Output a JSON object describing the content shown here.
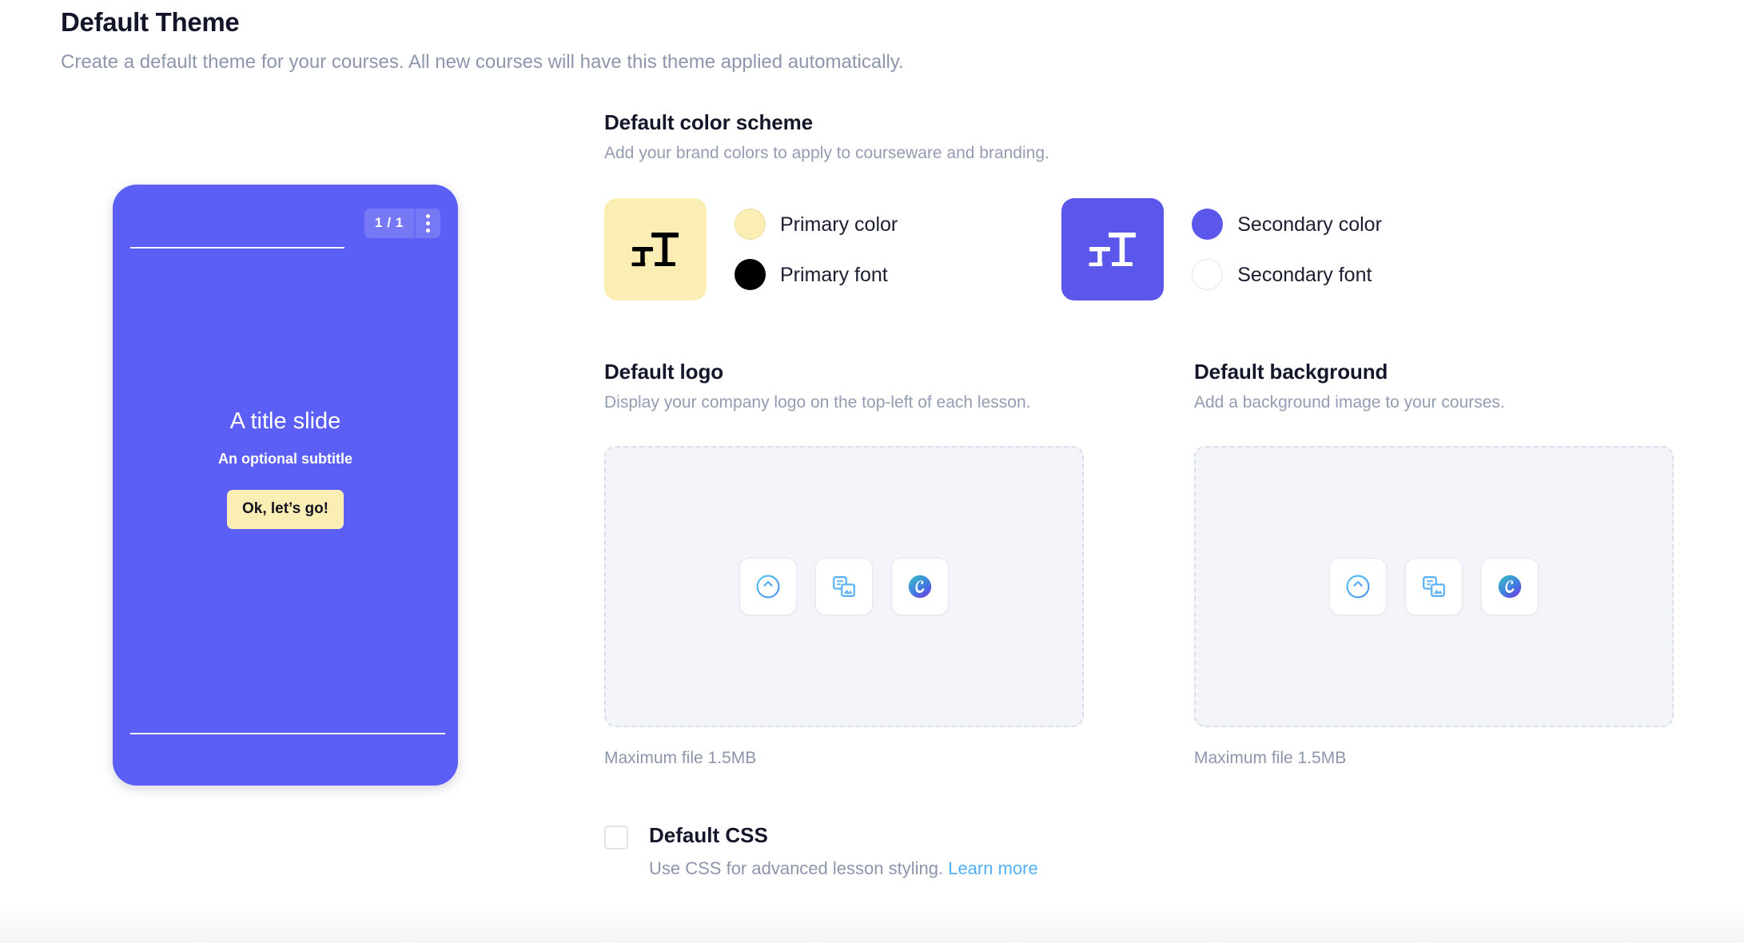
{
  "page": {
    "title": "Default Theme",
    "subtitle": "Create a default theme for your courses. All new courses will have this theme applied automatically."
  },
  "preview": {
    "slide_counter": "1 / 1",
    "menu_icon": "kebab-menu-icon",
    "title": "A title slide",
    "subtitle": "An optional subtitle",
    "cta_label": "Ok, let’s go!",
    "background_color": "#5C5FF5",
    "cta_background": "#FBEEB4",
    "cta_text_color": "#13141F"
  },
  "color_scheme": {
    "title": "Default color scheme",
    "subtitle": "Add your brand colors to apply to courseware and branding.",
    "primary": {
      "tile_color": "#FBEEB4",
      "tile_glyph": "Tt",
      "tile_glyph_color": "#000000",
      "swatches": [
        {
          "label": "Primary color",
          "color": "#FBEEB4"
        },
        {
          "label": "Primary font",
          "color": "#000000"
        }
      ]
    },
    "secondary": {
      "tile_color": "#5B57EB",
      "tile_glyph": "Tt",
      "tile_glyph_color": "#FFFFFF",
      "swatches": [
        {
          "label": "Secondary color",
          "color": "#5B57EB"
        },
        {
          "label": "Secondary font",
          "color": "#FFFFFF"
        }
      ]
    }
  },
  "uploads": [
    {
      "title": "Default logo",
      "subtitle": "Display your company logo on the top-left of each lesson.",
      "max_file": "Maximum file 1.5MB",
      "buttons": [
        {
          "icon": "upload-arrow-circle-icon"
        },
        {
          "icon": "media-library-icon"
        },
        {
          "icon": "canva-logo-icon"
        }
      ]
    },
    {
      "title": "Default background",
      "subtitle": "Add a background image to your courses.",
      "max_file": "Maximum file 1.5MB",
      "buttons": [
        {
          "icon": "upload-arrow-circle-icon"
        },
        {
          "icon": "media-library-icon"
        },
        {
          "icon": "canva-logo-icon"
        }
      ]
    }
  ],
  "default_css": {
    "checked": false,
    "title": "Default CSS",
    "description": "Use CSS for advanced lesson styling.",
    "link_label": "Learn more",
    "link_color": "#53B0F8"
  }
}
